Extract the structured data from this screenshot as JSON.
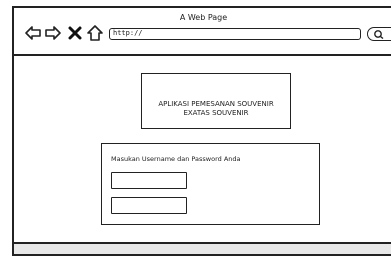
{
  "window": {
    "title": "A Web Page"
  },
  "toolbar": {
    "back_icon": "arrow-left-icon",
    "forward_icon": "arrow-right-icon",
    "stop_icon": "close-icon",
    "home_icon": "home-icon",
    "address": "http://",
    "search_icon": "search-icon"
  },
  "main": {
    "app_title_line1": "APLIKASI PEMESANAN SOUVENIR",
    "app_title_line2": "EXATAS SOUVENIR",
    "login": {
      "prompt": "Masukan Username dan Password Anda",
      "username_value": "",
      "password_value": ""
    }
  }
}
